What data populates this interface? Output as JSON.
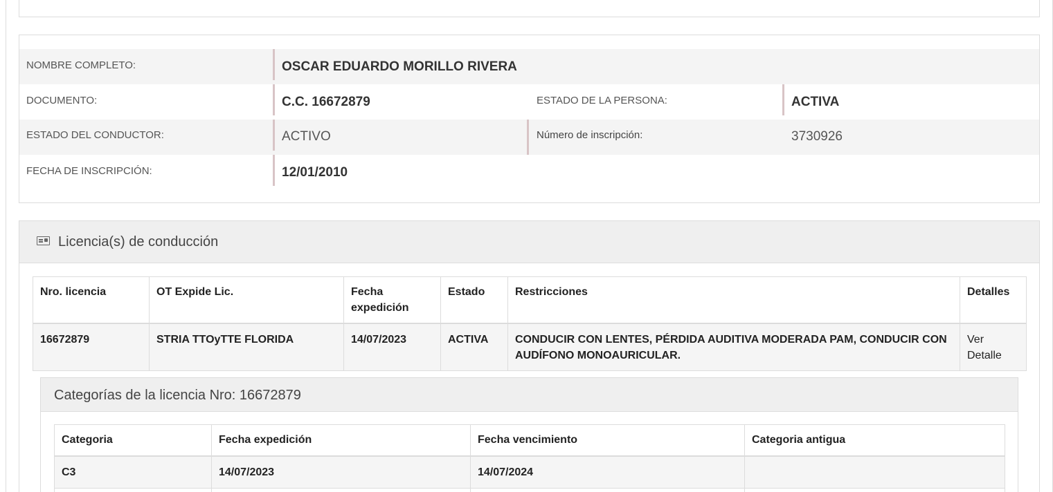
{
  "person": {
    "nombre_label": "NOMBRE COMPLETO:",
    "nombre_value": "OSCAR EDUARDO MORILLO RIVERA",
    "documento_label": "DOCUMENTO:",
    "documento_value": "C.C. 16672879",
    "estado_persona_label": "ESTADO DE LA PERSONA:",
    "estado_persona_value": "ACTIVA",
    "estado_conductor_label": "ESTADO DEL CONDUCTOR:",
    "estado_conductor_value": "ACTIVO",
    "numero_inscripcion_label": "Número de inscripción:",
    "numero_inscripcion_value": "3730926",
    "fecha_inscripcion_label": "FECHA DE INSCRIPCIÓN:",
    "fecha_inscripcion_value": "12/01/2010"
  },
  "licencias": {
    "icon": "id-card-icon",
    "title": "Licencia(s) de conducción",
    "columns": [
      "Nro. licencia",
      "OT Expide Lic.",
      "Fecha expedición",
      "Estado",
      "Restricciones",
      "Detalles"
    ],
    "rows": [
      {
        "nro": "16672879",
        "ot": "STRIA TTOyTTE FLORIDA",
        "fecha": "14/07/2023",
        "estado": "ACTIVA",
        "restricciones": "CONDUCIR CON LENTES, PÉRDIDA AUDITIVA MODERADA PAM, CONDUCIR CON AUDÍFONO MONOAURICULAR.",
        "detalles": "Ver Detalle"
      }
    ]
  },
  "categorias": {
    "title": "Categorías de la licencia Nro: 16672879",
    "columns": [
      "Categoria",
      "Fecha expedición",
      "Fecha vencimiento",
      "Categoria antigua"
    ],
    "rows": [
      {
        "categoria": "C3",
        "expedicion": "14/07/2023",
        "vencimiento": "14/07/2024",
        "antigua": ""
      }
    ]
  }
}
